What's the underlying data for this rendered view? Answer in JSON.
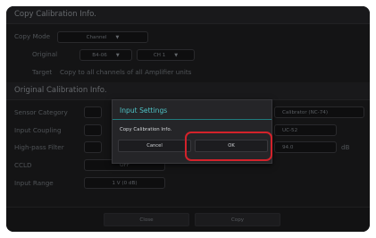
{
  "copy_section": {
    "title": "Copy Calibration Info.",
    "copy_mode_label": "Copy Mode",
    "copy_mode_value": "Channel",
    "original_label": "Original",
    "original_unit": "B4-06",
    "original_channel": "CH 1",
    "target_label": "Target",
    "target_value": "Copy to all channels of all Amplifier units"
  },
  "original_section": {
    "title": "Original Calibration Info.",
    "sensor_category_label": "Sensor Category",
    "sensor_category_value": "Calibrator (NC-74)",
    "input_coupling_label": "Input Coupling",
    "input_coupling_value": "UC-52",
    "highpass_label": "High-pass Filter",
    "highpass_value": "94.0",
    "highpass_unit": "dB",
    "ccld_label": "CCLD",
    "ccld_value": "OFF",
    "input_range_label": "Input Range",
    "input_range_value": "1 V (0 dB)"
  },
  "bottom": {
    "close_label": "Close",
    "copy_label": "Copy"
  },
  "dialog": {
    "title": "Input Settings",
    "message": "Copy Calibration Info.",
    "cancel_label": "Cancel",
    "ok_label": "OK"
  },
  "colors": {
    "accent": "#4ec3c6",
    "highlight": "#d3222b",
    "background": "#1c1c1e"
  }
}
